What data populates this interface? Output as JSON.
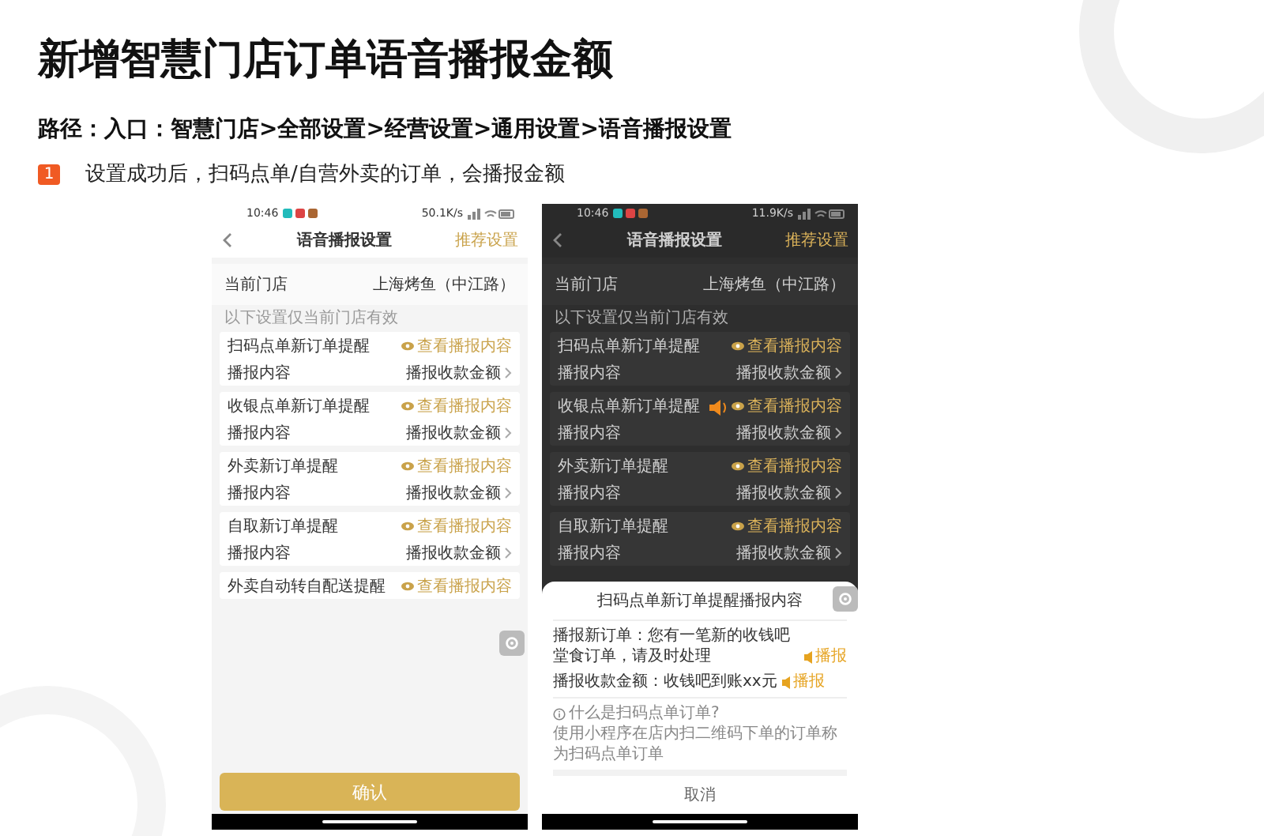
{
  "title": "新增智慧门店订单语音播报金额",
  "path": "路径：入口：智慧门店>全部设置>经营设置>通用设置>语音播报设置",
  "steps": [
    {
      "number": "1",
      "text": "设置成功后，扫码点单/自营外卖的订单，会播报金额"
    }
  ],
  "phones": [
    {
      "status_time": "10:46",
      "status_speed": "50.1K/s",
      "nav_title": "语音播报设置",
      "nav_action": "推荐设置",
      "store_label": "当前门店",
      "store_value": "上海烤鱼（中江路）",
      "section_note": "以下设置仅当前门店有效",
      "dimmed": false,
      "groups": [
        {
          "title": "扫码点单新订单提醒",
          "preview": "查看播报内容",
          "content_label": "播报内容",
          "content_value": "播报收款金额"
        },
        {
          "title": "收银点单新订单提醒",
          "preview": "查看播报内容",
          "content_label": "播报内容",
          "content_value": "播报收款金额"
        },
        {
          "title": "外卖新订单提醒",
          "preview": "查看播报内容",
          "content_label": "播报内容",
          "content_value": "播报收款金额"
        },
        {
          "title": "自取新订单提醒",
          "preview": "查看播报内容",
          "content_label": "播报内容",
          "content_value": "播报收款金额"
        },
        {
          "title": "外卖自动转自配送提醒",
          "preview": "查看播报内容"
        }
      ],
      "confirm": "确认"
    },
    {
      "status_time": "10:46",
      "status_speed": "11.9K/s",
      "nav_title": "语音播报设置",
      "nav_action": "推荐设置",
      "store_label": "当前门店",
      "store_value": "上海烤鱼（中江路）",
      "section_note": "以下设置仅当前门店有效",
      "dimmed": true,
      "groups": [
        {
          "title": "扫码点单新订单提醒",
          "preview": "查看播报内容",
          "content_label": "播报内容",
          "content_value": "播报收款金额"
        },
        {
          "title": "收银点单新订单提醒",
          "preview": "查看播报内容",
          "content_label": "播报内容",
          "content_value": "播报收款金额"
        },
        {
          "title": "外卖新订单提醒",
          "preview": "查看播报内容",
          "content_label": "播报内容",
          "content_value": "播报收款金额"
        },
        {
          "title": "自取新订单提醒",
          "preview": "查看播报内容",
          "content_label": "播报内容",
          "content_value": "播报收款金额"
        }
      ],
      "sheet": {
        "title": "扫码点单新订单提醒播报内容",
        "lines": [
          {
            "text": "播报新订单：您有一笔新的收钱吧堂食订单，请及时处理",
            "play": "播报"
          },
          {
            "text": "播报收款金额：收钱吧到账xx元",
            "play": "播报"
          }
        ],
        "help_title": "什么是扫码点单订单?",
        "help_text": "使用小程序在店内扫二维码下单的订单称为扫码点单订单",
        "cancel": "取消"
      }
    }
  ]
}
